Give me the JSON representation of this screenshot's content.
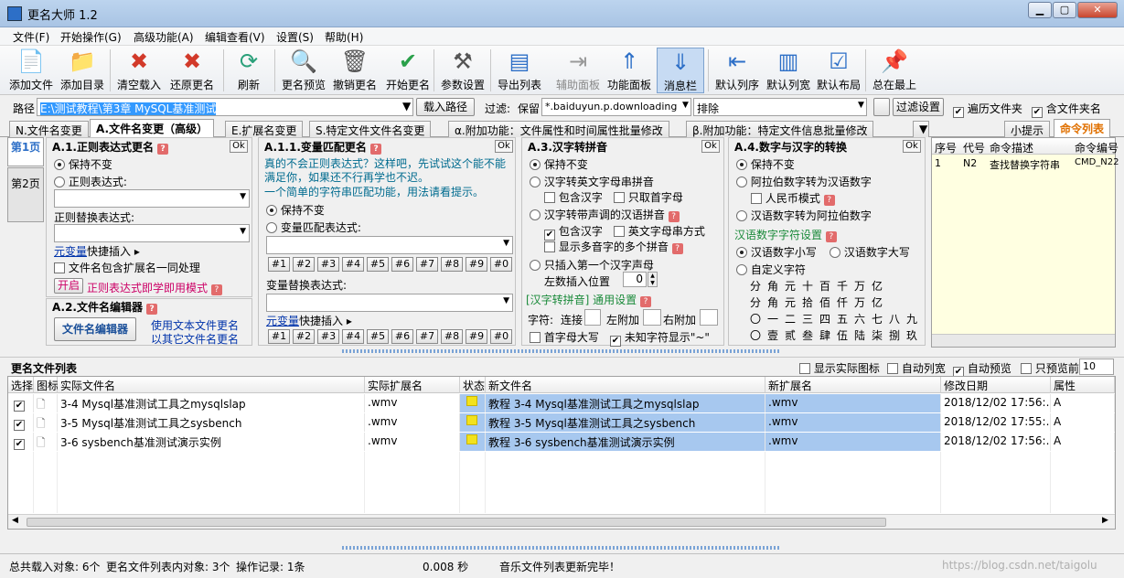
{
  "window": {
    "title": "更名大师 1.2"
  },
  "menu": [
    "文件(F)",
    "开始操作(G)",
    "高级功能(A)",
    "编辑查看(V)",
    "设置(S)",
    "帮助(H)"
  ],
  "toolbar": [
    {
      "label": "添加文件",
      "icon": "add-file-icon",
      "color": "#2e8b2e",
      "glyph": "📄"
    },
    {
      "label": "添加目录",
      "icon": "add-folder-icon",
      "color": "#c8912e",
      "glyph": "📁"
    },
    {
      "label": "清空载入",
      "icon": "clear-icon",
      "color": "#d23a2a",
      "glyph": "✖"
    },
    {
      "label": "还原更名",
      "icon": "restore-icon",
      "color": "#d23a2a",
      "glyph": "✖"
    },
    {
      "label": "刷新",
      "icon": "refresh-icon",
      "color": "#2aa07a",
      "glyph": "⟳"
    },
    {
      "label": "更名预览",
      "icon": "preview-icon",
      "color": "#2d6fc7",
      "glyph": "🔍"
    },
    {
      "label": "撤销更名",
      "icon": "undo-rename-icon",
      "color": "#555",
      "glyph": "🗑"
    },
    {
      "label": "开始更名",
      "icon": "start-rename-icon",
      "color": "#2aa04a",
      "glyph": "✔"
    },
    {
      "label": "参数设置",
      "icon": "settings-icon",
      "color": "#555",
      "glyph": "⚒"
    },
    {
      "label": "导出列表",
      "icon": "export-list-icon",
      "color": "#2d6fc7",
      "glyph": "▤"
    },
    {
      "label": "辅助面板",
      "icon": "aux-panel-icon",
      "color": "#999",
      "glyph": "⇥"
    },
    {
      "label": "功能面板",
      "icon": "function-panel-icon",
      "color": "#2d6fc7",
      "glyph": "⇑"
    },
    {
      "label": "消息栏",
      "icon": "message-bar-icon",
      "color": "#2d6fc7",
      "glyph": "⇓"
    },
    {
      "label": "默认列序",
      "icon": "default-col-order-icon",
      "color": "#2d6fc7",
      "glyph": "⇤"
    },
    {
      "label": "默认列宽",
      "icon": "default-col-width-icon",
      "color": "#2d6fc7",
      "glyph": "▥"
    },
    {
      "label": "默认布局",
      "icon": "default-layout-icon",
      "color": "#2d6fc7",
      "glyph": "☑"
    },
    {
      "label": "总在最上",
      "icon": "pin-icon",
      "color": "#2aa04a",
      "glyph": "📌"
    }
  ],
  "pathbar": {
    "label": "路径",
    "path": "E:\\测试教程\\第3章 MySQL基准测试",
    "load_btn": "载入路径",
    "filter_label": "过滤:",
    "keep": "保留",
    "keep_value": "*.baiduyun.p.downloading",
    "exclude": "排除",
    "filter_btn": "过滤设置",
    "traverse": "遍历文件夹",
    "include_folder": "含文件夹名"
  },
  "tabs": [
    "N.文件名变更",
    "A.文件名变更（高级）",
    "E.扩展名变更",
    "S.特定文件文件名变更",
    "α.附加功能：文件属性和时间属性批量修改",
    "β.附加功能：特定文件信息批量修改"
  ],
  "right_tabs": [
    "小提示",
    "命令列表"
  ],
  "side_tabs": [
    "第1页",
    "第2页"
  ],
  "a1": {
    "title": "A.1.正则表达式更名",
    "ok": "Ok",
    "keep": "保持不变",
    "regex": "正则表达式:",
    "replace": "正则替换表达式:",
    "meta": "元变量",
    "quick": "快捷插入",
    "ext": "文件名包含扩展名一同处理",
    "open": "开启",
    "instant": "正则表达式即学即用模式"
  },
  "a2": {
    "title": "A.2.文件名编辑器",
    "btn": "文件名编辑器",
    "desc1": "使用文本文件更名",
    "desc2": "以其它文件名更名"
  },
  "a11": {
    "title": "A.1.1.变量匹配更名",
    "ok": "Ok",
    "tip1": "真的不会正则表达式？这样吧，先试试这个能不能",
    "tip2": "满足你，如果还不行再学也不迟。",
    "tip3": "一个简单的字符串匹配功能，用法请看提示。",
    "keep": "保持不变",
    "match": "变量匹配表达式:",
    "replace": "变量替换表达式:",
    "meta": "元变量",
    "quick": "快捷插入",
    "nums": [
      "#1",
      "#2",
      "#3",
      "#4",
      "#5",
      "#6",
      "#7",
      "#8",
      "#9",
      "#0"
    ]
  },
  "a3": {
    "title": "A.3.汉字转拼音",
    "ok": "Ok",
    "keep": "保持不变",
    "r1": "汉字转英文字母串拼音",
    "c1": "包含汉字",
    "c2": "只取首字母",
    "r2": "汉字转带声调的汉语拼音",
    "c3": "包含汉字",
    "c4": "英文字母串方式",
    "c5": "显示多音字的多个拼音",
    "r3": "只插入第一个汉字声母",
    "leftpos": "左数插入位置",
    "leftpos_val": "0",
    "general": "[汉字转拼音] 通用设置",
    "char": "字符:",
    "connect": "连接",
    "leftadd": "左附加",
    "rightadd": "右附加",
    "cap": "首字母大写",
    "unknown": "未知字符显示\"~\""
  },
  "a4": {
    "title": "A.4.数字与汉字的转换",
    "ok": "Ok",
    "keep": "保持不变",
    "r1": "阿拉伯数字转为汉语数字",
    "rmb": "人民币模式",
    "r2": "汉语数字转为阿拉伯数字",
    "set": "汉语数字字符设置",
    "small": "汉语数字小写",
    "big": "汉语数字大写",
    "custom": "自定义字符",
    "row1": [
      "分",
      "角",
      "元",
      "十",
      "百",
      "千",
      "万",
      "亿"
    ],
    "row2": [
      "分",
      "角",
      "元",
      "拾",
      "佰",
      "仟",
      "万",
      "亿"
    ],
    "row3": [
      "〇",
      "一",
      "二",
      "三",
      "四",
      "五",
      "六",
      "七",
      "八",
      "九"
    ],
    "row4": [
      "〇",
      "壹",
      "贰",
      "叁",
      "肆",
      "伍",
      "陆",
      "柒",
      "捌",
      "玖"
    ]
  },
  "cmdlist": {
    "headers": [
      "序号",
      "代号",
      "命令描述",
      "命令编号"
    ],
    "rows": [
      [
        "1",
        "N2",
        "查找替换字符串",
        "CMD_N22"
      ]
    ]
  },
  "filelist": {
    "title": "更名文件列表",
    "show_icon": "显示实际图标",
    "auto_width": "自动列宽",
    "auto_preview": "自动预览",
    "only_preview": "只预览前",
    "preview_count": "10",
    "headers": [
      "选择",
      "图标",
      "实际文件名",
      "实际扩展名",
      "状态",
      "新文件名",
      "新扩展名",
      "修改日期",
      "属性"
    ],
    "rows": [
      {
        "name": "3-4 Mysql基准测试工具之mysqlslap",
        "ext": ".wmv",
        "newname": "教程 3-4 Mysql基准测试工具之mysqlslap",
        "newext": ".wmv",
        "date": "2018/12/02 17:56:...",
        "attr": "A"
      },
      {
        "name": "3-5 Mysql基准测试工具之sysbench",
        "ext": ".wmv",
        "newname": "教程 3-5 Mysql基准测试工具之sysbench",
        "newext": ".wmv",
        "date": "2018/12/02 17:55:...",
        "attr": "A"
      },
      {
        "name": "3-6 sysbench基准测试演示实例",
        "ext": ".wmv",
        "newname": "教程 3-6 sysbench基准测试演示实例",
        "newext": ".wmv",
        "date": "2018/12/02 17:56:...",
        "attr": "A"
      }
    ]
  },
  "status": {
    "total": "总共载入对象: 6个",
    "inlist": "更名文件列表内对象: 3个",
    "ops": "操作记录: 1条",
    "time": "0.008 秒",
    "msg": "音乐文件列表更新完毕！",
    "watermark": "https://blog.csdn.net/taigolu"
  }
}
